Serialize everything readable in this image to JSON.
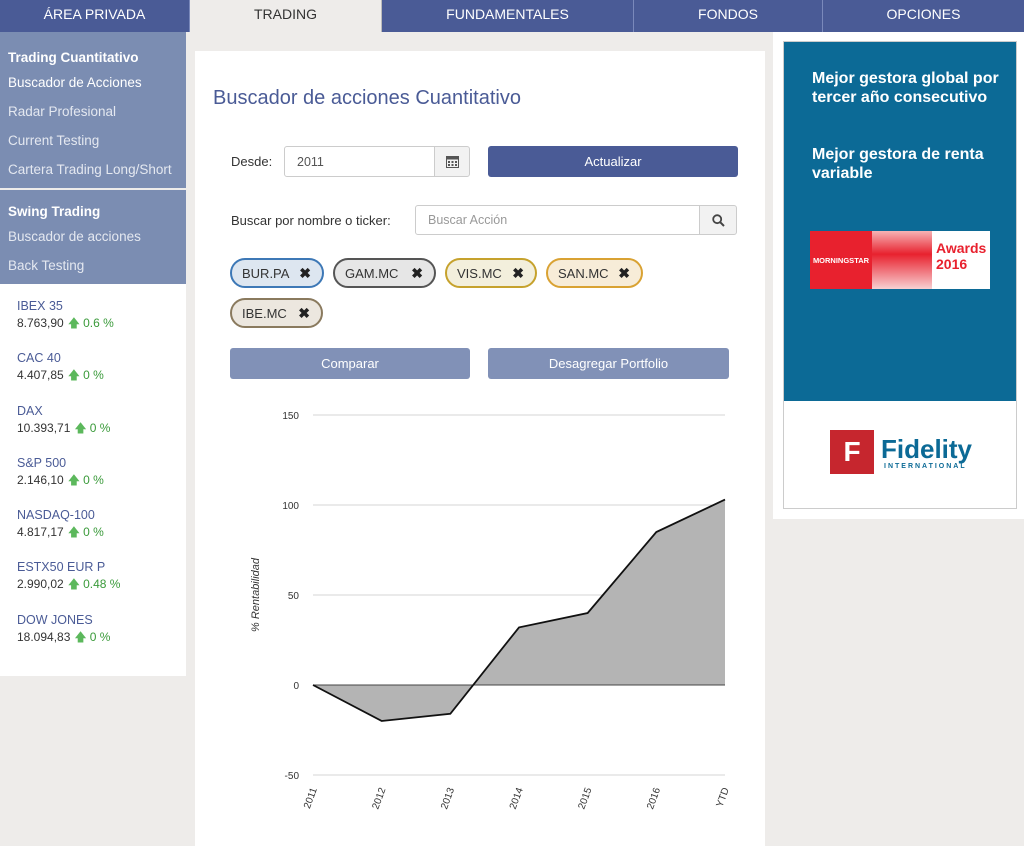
{
  "nav": [
    {
      "label": "ÁREA PRIVADA"
    },
    {
      "label": "TRADING"
    },
    {
      "label": "FUNDAMENTALES"
    },
    {
      "label": "FONDOS"
    },
    {
      "label": "OPCIONES"
    }
  ],
  "sidebar": {
    "quant_heading": "Trading Cuantitativo",
    "quant_items": [
      "Buscador de Acciones",
      "Radar Profesional",
      "Current Testing",
      "Cartera Trading Long/Short"
    ],
    "swing_heading": "Swing Trading",
    "swing_items": [
      "Buscador de acciones",
      "Back Testing"
    ]
  },
  "indices": [
    {
      "name": "IBEX 35",
      "value": "8.763,90",
      "change": "0.6 %"
    },
    {
      "name": "CAC 40",
      "value": "4.407,85",
      "change": "0 %"
    },
    {
      "name": "DAX",
      "value": "10.393,71",
      "change": "0 %"
    },
    {
      "name": "S&P 500",
      "value": "2.146,10",
      "change": "0 %"
    },
    {
      "name": "NASDAQ-100",
      "value": "4.817,17",
      "change": "0 %"
    },
    {
      "name": "ESTX50 EUR P",
      "value": "2.990,02",
      "change": "0.48 %"
    },
    {
      "name": "DOW JONES",
      "value": "18.094,83",
      "change": "0 %"
    }
  ],
  "main": {
    "title": "Buscador de acciones Cuantitativo",
    "desde_label": "Desde:",
    "desde_value": "2011",
    "actualizar_label": "Actualizar",
    "search_label": "Buscar por nombre o ticker:",
    "search_placeholder": "Buscar Acción",
    "tags": [
      {
        "label": "BUR.PA",
        "bg": "#dde6f0",
        "border": "#3d78b6"
      },
      {
        "label": "GAM.MC",
        "bg": "#e6e6e6",
        "border": "#555555"
      },
      {
        "label": "VIS.MC",
        "bg": "#f3efdc",
        "border": "#c6a22d"
      },
      {
        "label": "SAN.MC",
        "bg": "#f7ecd8",
        "border": "#d9a233"
      },
      {
        "label": "IBE.MC",
        "bg": "#ece7df",
        "border": "#8a7a5e"
      }
    ],
    "comparar_label": "Comparar",
    "desagregar_label": "Desagregar Portfolio"
  },
  "chart_data": {
    "type": "area",
    "x": [
      "2011",
      "2012",
      "2013",
      "2014",
      "2015",
      "2016",
      "YTD"
    ],
    "values": [
      0,
      -20,
      -16,
      32,
      40,
      85,
      103
    ],
    "ylabel": "% Rentabilidad",
    "yticks": [
      150,
      100,
      50,
      0,
      -50
    ],
    "ylim": [
      -50,
      150
    ],
    "grid": true,
    "fill_color": "#b4b4b4",
    "line_color": "#111111"
  },
  "ad": {
    "text1": "Mejor gestora global por tercer año consecutivo",
    "text2": "Mejor gestora de renta variable",
    "ms_brand": "MORNINGSTAR",
    "ms_awards": "Awards",
    "ms_year": "2016",
    "fid_mark": "F",
    "fid_name": "Fidelity",
    "fid_sub": "INTERNATIONAL",
    "bg_color": "#0c6a96"
  }
}
